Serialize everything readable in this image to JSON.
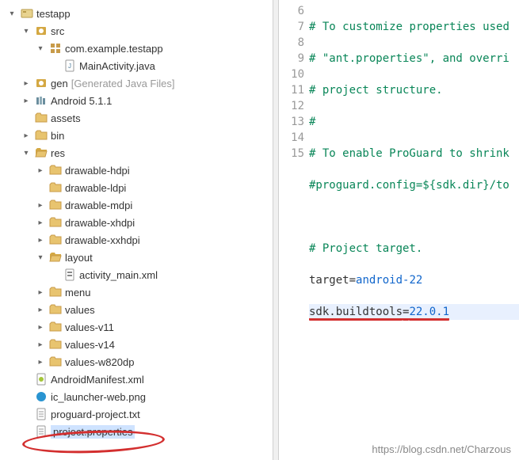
{
  "tree": {
    "root": "testapp",
    "src": "src",
    "package": "com.example.testapp",
    "main_activity": "MainActivity.java",
    "gen": "gen",
    "gen_note": "[Generated Java Files]",
    "android": "Android 5.1.1",
    "assets": "assets",
    "bin": "bin",
    "res": "res",
    "drawable_hdpi": "drawable-hdpi",
    "drawable_ldpi": "drawable-ldpi",
    "drawable_mdpi": "drawable-mdpi",
    "drawable_xhdpi": "drawable-xhdpi",
    "drawable_xxhdpi": "drawable-xxhdpi",
    "layout": "layout",
    "activity_main": "activity_main.xml",
    "menu": "menu",
    "values": "values",
    "values_v11": "values-v11",
    "values_v14": "values-v14",
    "values_w820dp": "values-w820dp",
    "android_manifest": "AndroidManifest.xml",
    "ic_launcher": "ic_launcher-web.png",
    "proguard": "proguard-project.txt",
    "project_properties": "project.properties"
  },
  "code": {
    "lines": {
      "n6": "6",
      "n7": "7",
      "n8": "8",
      "n9": "9",
      "n10": "10",
      "n11": "11",
      "n12": "12",
      "n13": "13",
      "n14": "14",
      "n15": "15"
    },
    "l6a": "#",
    "l6b": " To customize properties used",
    "l7": "# \"ant.properties\", and overri",
    "l8": "# project structure.",
    "l9": "#",
    "l10": "# To enable ProGuard to shrink",
    "l11": "#proguard.config=${sdk.dir}/to",
    "l13": "# Project target.",
    "l14k": "target",
    "l14e": "=",
    "l14v": "android-22",
    "l15k": "sdk.buildtools",
    "l15e": "=",
    "l15v": "22.0.1"
  },
  "watermark": "https://blog.csdn.net/Charzous"
}
